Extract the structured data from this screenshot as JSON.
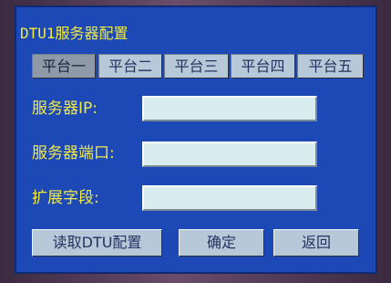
{
  "screen": {
    "title": "DTU1服务器配置"
  },
  "tabs": [
    {
      "label": "平台一",
      "active": true
    },
    {
      "label": "平台二",
      "active": false
    },
    {
      "label": "平台三",
      "active": false
    },
    {
      "label": "平台四",
      "active": false
    },
    {
      "label": "平台五",
      "active": false
    }
  ],
  "form": {
    "server_ip_label": "服务器IP:",
    "server_ip_value": "",
    "server_port_label": "服务器端口:",
    "server_port_value": "",
    "ext_field_label": "扩展字段:",
    "ext_field_value": ""
  },
  "buttons": {
    "read_config": "读取DTU配置",
    "confirm": "确定",
    "back": "返回"
  },
  "colors": {
    "screen_bg": "#1c49b6",
    "label_text": "#f2ea44",
    "tab_bg": "#b7c8d8",
    "tab_active_bg": "#8e9aa7",
    "field_bg": "#d9edef"
  }
}
